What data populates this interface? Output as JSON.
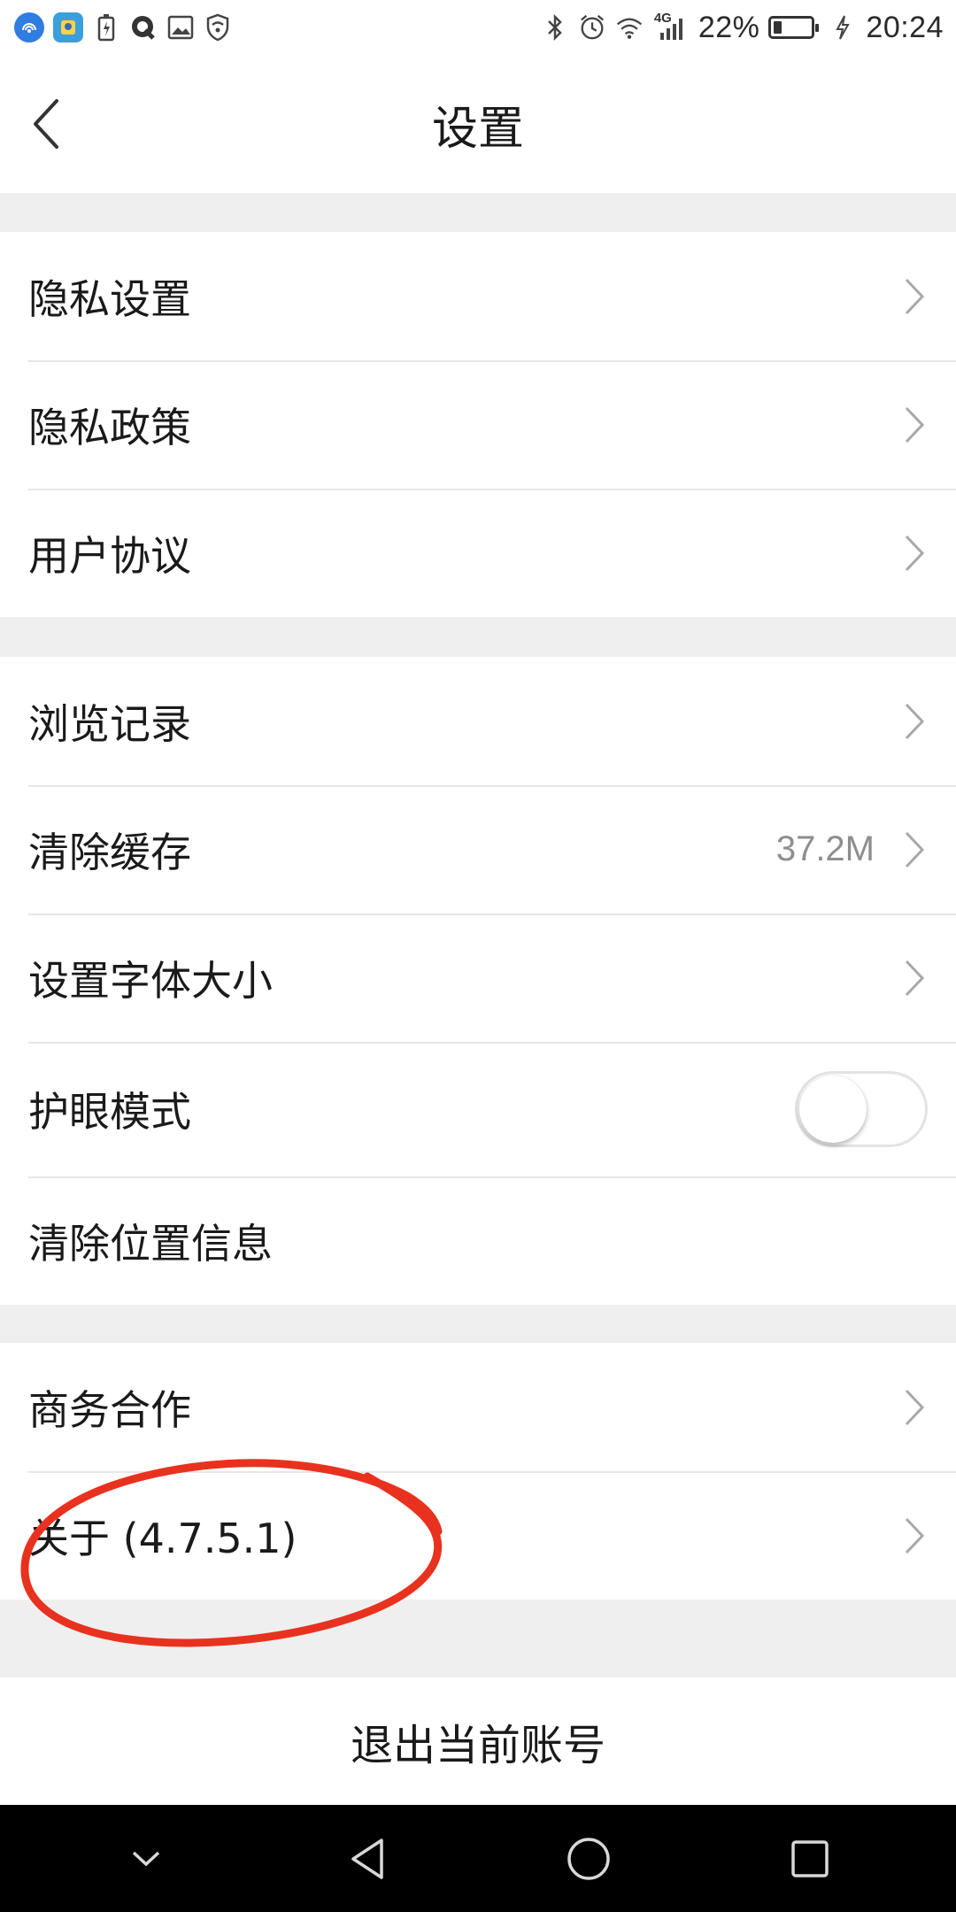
{
  "status_bar": {
    "battery_percent": "22%",
    "time": "20:24",
    "network": "4G",
    "battery_level": 0.22,
    "icons": [
      "signal-app-icon",
      "photo-app-icon",
      "battery-saver-icon",
      "q-app-icon",
      "image-icon",
      "shield-icon",
      "bluetooth-icon",
      "alarm-icon",
      "wifi-icon",
      "cellular-icon",
      "charging-icon"
    ]
  },
  "header": {
    "title": "设置",
    "back_icon": "chevron-left-icon"
  },
  "sections": [
    {
      "items": [
        {
          "label": "隐私设置"
        },
        {
          "label": "隐私政策"
        },
        {
          "label": "用户协议"
        }
      ]
    },
    {
      "items": [
        {
          "label": "浏览记录"
        },
        {
          "label": "清除缓存",
          "value": "37.2M"
        },
        {
          "label": "设置字体大小"
        },
        {
          "label": "护眼模式",
          "toggle": false
        },
        {
          "label": "清除位置信息"
        }
      ]
    },
    {
      "items": [
        {
          "label": "商务合作"
        },
        {
          "label": "关于 (4.7.5.1)"
        }
      ]
    }
  ],
  "logout": {
    "label": "退出当前账号"
  },
  "nav_bar": {
    "buttons": [
      "collapse-icon",
      "back-triangle-icon",
      "home-circle-icon",
      "recents-square-icon"
    ]
  },
  "colors": {
    "background": "#efefef",
    "surface": "#ffffff",
    "text": "#1a1a1a",
    "secondary_text": "#8e8e8e",
    "annotation_red": "#e8321f"
  }
}
